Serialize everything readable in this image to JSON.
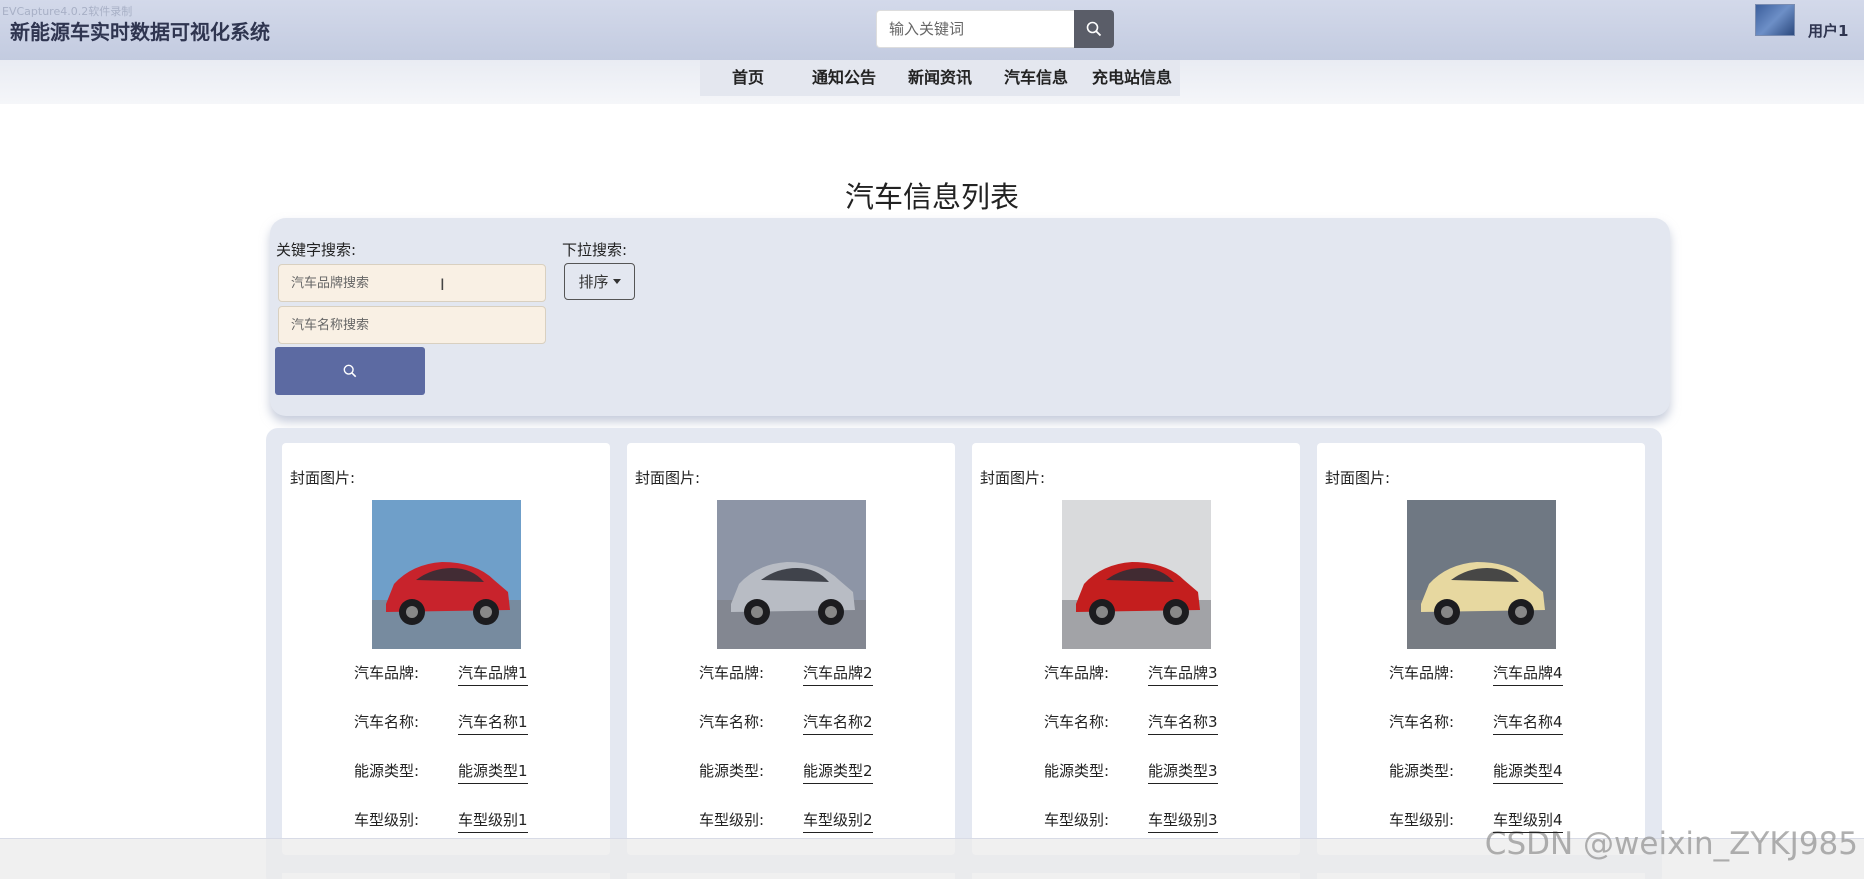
{
  "watermark_top": "EVCapture4.0.2软件录制",
  "header": {
    "title": "新能源车实时数据可视化系统",
    "search_placeholder": "输入关键词",
    "user_name": "用户1"
  },
  "nav": {
    "items": [
      {
        "label": "首页"
      },
      {
        "label": "通知公告"
      },
      {
        "label": "新闻资讯"
      },
      {
        "label": "汽车信息"
      },
      {
        "label": "充电站信息"
      }
    ]
  },
  "page_title": "汽车信息列表",
  "search": {
    "keyword_label": "关键字搜索:",
    "brand_placeholder": "汽车品牌搜索",
    "name_placeholder": "汽车名称搜索",
    "dropdown_label": "下拉搜索:",
    "sort_label": "排序"
  },
  "cards": [
    {
      "cover_label": "封面图片:",
      "brand_key": "汽车品牌:",
      "brand": "汽车品牌1",
      "name_key": "汽车名称:",
      "name": "汽车名称1",
      "energy_key": "能源类型:",
      "energy": "能源类型1",
      "level_key": "车型级别:",
      "level": "车型级别1",
      "car_color": "#c8232c",
      "bg_color": "#6f9fc9"
    },
    {
      "cover_label": "封面图片:",
      "brand_key": "汽车品牌:",
      "brand": "汽车品牌2",
      "name_key": "汽车名称:",
      "name": "汽车名称2",
      "energy_key": "能源类型:",
      "energy": "能源类型2",
      "level_key": "车型级别:",
      "level": "车型级别2",
      "car_color": "#b8bcc4",
      "bg_color": "#8d95a6"
    },
    {
      "cover_label": "封面图片:",
      "brand_key": "汽车品牌:",
      "brand": "汽车品牌3",
      "name_key": "汽车名称:",
      "name": "汽车名称3",
      "energy_key": "能源类型:",
      "energy": "能源类型3",
      "level_key": "车型级别:",
      "level": "车型级别3",
      "car_color": "#c41e1e",
      "bg_color": "#d9dadc"
    },
    {
      "cover_label": "封面图片:",
      "brand_key": "汽车品牌:",
      "brand": "汽车品牌4",
      "name_key": "汽车名称:",
      "name": "汽车名称4",
      "energy_key": "能源类型:",
      "energy": "能源类型4",
      "level_key": "车型级别:",
      "level": "车型级别4",
      "car_color": "#e7d8a0",
      "bg_color": "#6f7883"
    }
  ],
  "csdn_watermark": "CSDN @weixin_ZYKJ985",
  "colors": {
    "header_bg": "#c8cfe3",
    "search_button": "#5c6aa2",
    "panel_bg": "#e3e7f0",
    "input_bg": "#f9f0e4"
  }
}
